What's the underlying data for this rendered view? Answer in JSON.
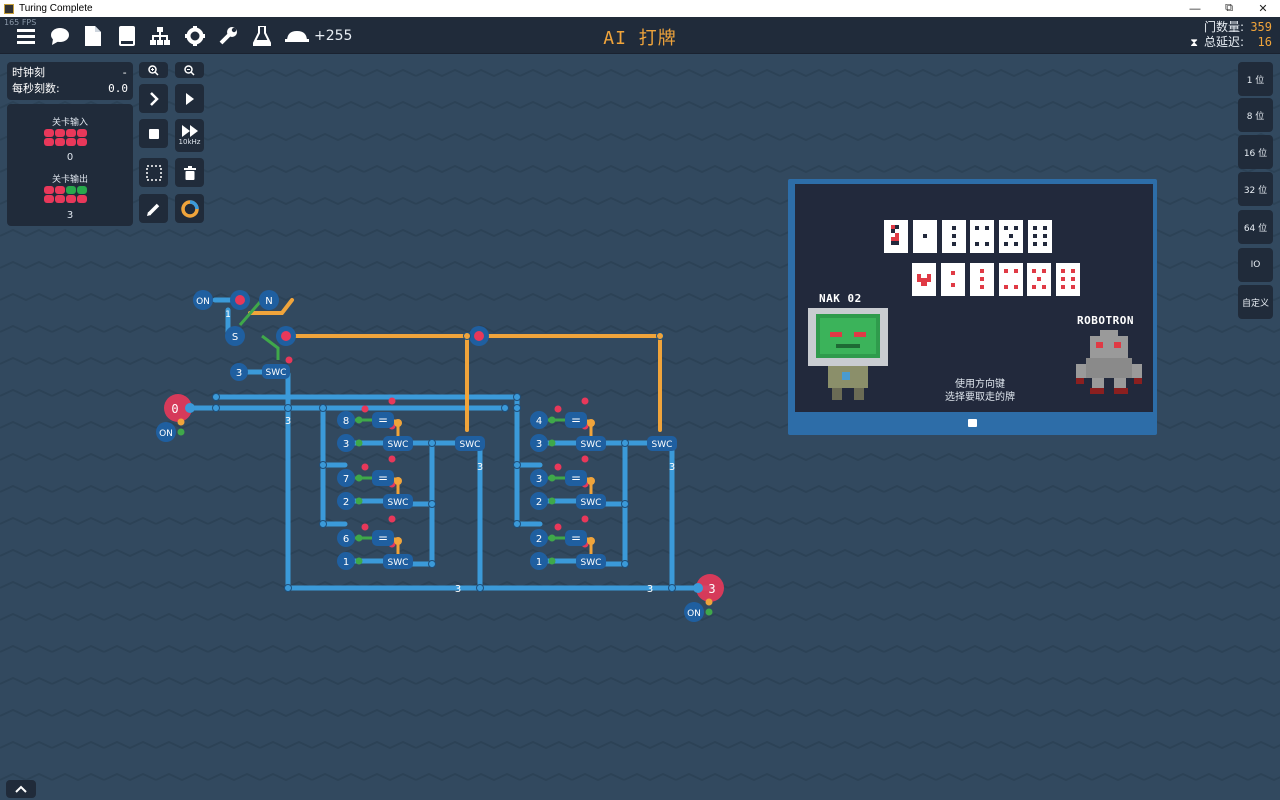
{
  "window": {
    "title": "Turing Complete",
    "controls": {
      "minimize": "—",
      "restore": "⧉",
      "close": "✕"
    }
  },
  "toolbar": {
    "fps": "165 FPS",
    "icons": [
      "menu-icon",
      "chat-icon",
      "document-icon",
      "book-icon",
      "hierarchy-icon",
      "gear-icon",
      "wrench-icon",
      "flask-icon",
      "hat-icon"
    ],
    "score": "+255",
    "level_title": "AI 打牌",
    "gate_count_label": "门数量:",
    "gate_count": "359",
    "delay_label": "总延迟:",
    "delay": "16"
  },
  "clock_panel": {
    "tick_label": "时钟刻",
    "tick_value": "-",
    "tps_label": "每秒刻数:",
    "tps_value": "0.0"
  },
  "io_panel": {
    "input_title": "关卡输入",
    "input_value": "0",
    "output_title": "关卡输出",
    "output_value": "3"
  },
  "tools": {
    "zoom_in": "zoom-in-icon",
    "zoom_out": "zoom-out-icon",
    "step": "step-icon",
    "play": "play-icon",
    "stop": "stop-icon",
    "fast_label": "10kHz",
    "select": "select-icon",
    "delete": "trash-icon",
    "pencil": "pencil-icon",
    "color": "color-ring-icon"
  },
  "bit_widths": [
    "1 位",
    "8 位",
    "16 位",
    "32 位",
    "64 位",
    "IO",
    "自定义"
  ],
  "game": {
    "player_name": "NAK 02",
    "opponent_name": "ROBOTRON",
    "message_line1": "使用方向键",
    "message_line2": "选择要取走的牌",
    "colors": {
      "frame": "#2d6da8",
      "bg": "#22293c",
      "red": "#e03a45"
    }
  },
  "circuit": {
    "on_labels": [
      "ON",
      "ON",
      "ON"
    ],
    "n_label": "N",
    "s_label": "S",
    "one_label": "1",
    "const3_label": "3",
    "swc_label": "SWC",
    "eq_label": "=",
    "input_pin_label": "0",
    "output_pin_label": "3",
    "wire_label_3": "3",
    "left_consts": [
      "8",
      "3",
      "7",
      "2",
      "6",
      "1"
    ],
    "right_consts": [
      "4",
      "3",
      "3",
      "2",
      "2",
      "1"
    ],
    "colors": {
      "wire_blue": "#3b9ad9",
      "wire_orange": "#f0a43b",
      "node": "#1f5fa0",
      "pin": "#e8385a"
    }
  }
}
